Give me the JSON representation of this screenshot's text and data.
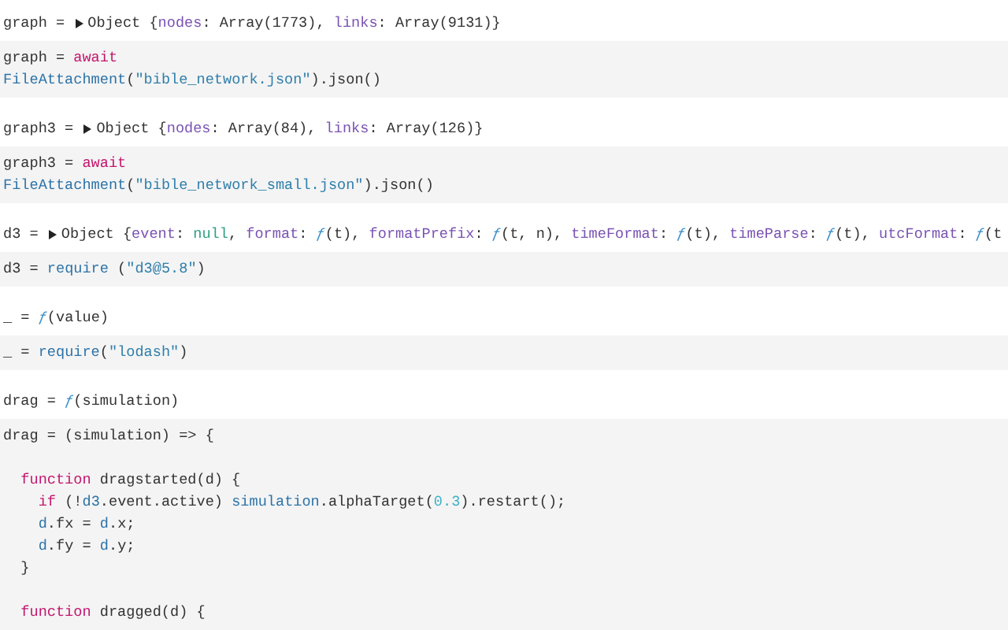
{
  "cells": [
    {
      "output": {
        "expanded": false,
        "tokens": [
          {
            "kind": "plain",
            "text": "graph = "
          },
          {
            "kind": "plain",
            "text": "Object {"
          },
          {
            "kind": "prop",
            "text": "nodes"
          },
          {
            "kind": "plain",
            "text": ": Array(1773), "
          },
          {
            "kind": "prop",
            "text": "links"
          },
          {
            "kind": "plain",
            "text": ": Array(9131)}"
          }
        ]
      },
      "source": [
        {
          "kind": "code",
          "tokens": [
            {
              "kind": "plain",
              "text": "graph = "
            },
            {
              "kind": "keyword",
              "text": "await"
            }
          ]
        },
        {
          "kind": "code",
          "tokens": [
            {
              "kind": "name",
              "text": "FileAttachment"
            },
            {
              "kind": "plain",
              "text": "("
            },
            {
              "kind": "string",
              "text": "\"bible_network.json\""
            },
            {
              "kind": "plain",
              "text": ").json()"
            }
          ]
        }
      ]
    },
    {
      "output": {
        "expanded": false,
        "tokens": [
          {
            "kind": "plain",
            "text": "graph3 = "
          },
          {
            "kind": "plain",
            "text": "Object {"
          },
          {
            "kind": "prop",
            "text": "nodes"
          },
          {
            "kind": "plain",
            "text": ": Array(84), "
          },
          {
            "kind": "prop",
            "text": "links"
          },
          {
            "kind": "plain",
            "text": ": Array(126)}"
          }
        ]
      },
      "source": [
        {
          "kind": "code",
          "tokens": [
            {
              "kind": "plain",
              "text": "graph3 = "
            },
            {
              "kind": "keyword",
              "text": "await"
            }
          ]
        },
        {
          "kind": "code",
          "tokens": [
            {
              "kind": "name",
              "text": "FileAttachment"
            },
            {
              "kind": "plain",
              "text": "("
            },
            {
              "kind": "string",
              "text": "\"bible_network_small.json\""
            },
            {
              "kind": "plain",
              "text": ").json()"
            }
          ]
        }
      ]
    },
    {
      "output": {
        "expanded": false,
        "tokens": [
          {
            "kind": "plain",
            "text": "d3 = "
          },
          {
            "kind": "plain",
            "text": "Object {"
          },
          {
            "kind": "prop",
            "text": "event"
          },
          {
            "kind": "plain",
            "text": ": "
          },
          {
            "kind": "null",
            "text": "null"
          },
          {
            "kind": "plain",
            "text": ", "
          },
          {
            "kind": "prop",
            "text": "format"
          },
          {
            "kind": "plain",
            "text": ": "
          },
          {
            "kind": "f",
            "text": "ƒ"
          },
          {
            "kind": "plain",
            "text": "(t), "
          },
          {
            "kind": "prop",
            "text": "formatPrefix"
          },
          {
            "kind": "plain",
            "text": ": "
          },
          {
            "kind": "f",
            "text": "ƒ"
          },
          {
            "kind": "plain",
            "text": "(t, n), "
          },
          {
            "kind": "prop",
            "text": "timeFormat"
          },
          {
            "kind": "plain",
            "text": ": "
          },
          {
            "kind": "f",
            "text": "ƒ"
          },
          {
            "kind": "plain",
            "text": "(t), "
          },
          {
            "kind": "prop",
            "text": "timeParse"
          },
          {
            "kind": "plain",
            "text": ": "
          },
          {
            "kind": "f",
            "text": "ƒ"
          },
          {
            "kind": "plain",
            "text": "(t), "
          },
          {
            "kind": "prop",
            "text": "utcFormat"
          },
          {
            "kind": "plain",
            "text": ": "
          },
          {
            "kind": "f",
            "text": "ƒ"
          },
          {
            "kind": "plain",
            "text": "(t"
          }
        ]
      },
      "source": [
        {
          "kind": "code",
          "tokens": [
            {
              "kind": "plain",
              "text": "d3 = "
            },
            {
              "kind": "name",
              "text": "require"
            },
            {
              "kind": "plain",
              "text": " ("
            },
            {
              "kind": "string",
              "text": "\"d3@5.8\""
            },
            {
              "kind": "plain",
              "text": ")"
            }
          ]
        }
      ]
    },
    {
      "output": {
        "tokens": [
          {
            "kind": "plain",
            "text": "_ = "
          },
          {
            "kind": "f",
            "text": "ƒ"
          },
          {
            "kind": "plain",
            "text": "(value)"
          }
        ]
      },
      "source": [
        {
          "kind": "code",
          "tokens": [
            {
              "kind": "plain",
              "text": "_ = "
            },
            {
              "kind": "name",
              "text": "require"
            },
            {
              "kind": "plain",
              "text": "("
            },
            {
              "kind": "string",
              "text": "\"lodash\""
            },
            {
              "kind": "plain",
              "text": ")"
            }
          ]
        }
      ]
    },
    {
      "output": {
        "tokens": [
          {
            "kind": "plain",
            "text": "drag = "
          },
          {
            "kind": "f",
            "text": "ƒ"
          },
          {
            "kind": "plain",
            "text": "(simulation)"
          }
        ]
      },
      "source": [
        {
          "kind": "code",
          "tokens": [
            {
              "kind": "plain",
              "text": "drag = (simulation) => {"
            }
          ]
        },
        {
          "kind": "blank"
        },
        {
          "kind": "code",
          "tokens": [
            {
              "kind": "keyword",
              "text": "  function"
            },
            {
              "kind": "plain",
              "text": " dragstarted(d) {"
            }
          ]
        },
        {
          "kind": "code",
          "tokens": [
            {
              "kind": "keyword",
              "text": "    if"
            },
            {
              "kind": "plain",
              "text": " (!"
            },
            {
              "kind": "name",
              "text": "d3"
            },
            {
              "kind": "plain",
              "text": ".event.active) "
            },
            {
              "kind": "name",
              "text": "simulation"
            },
            {
              "kind": "plain",
              "text": ".alphaTarget("
            },
            {
              "kind": "number",
              "text": "0.3"
            },
            {
              "kind": "plain",
              "text": ").restart();"
            }
          ]
        },
        {
          "kind": "code",
          "tokens": [
            {
              "kind": "name",
              "text": "    d"
            },
            {
              "kind": "plain",
              "text": ".fx = "
            },
            {
              "kind": "name",
              "text": "d"
            },
            {
              "kind": "plain",
              "text": ".x;"
            }
          ]
        },
        {
          "kind": "code",
          "tokens": [
            {
              "kind": "name",
              "text": "    d"
            },
            {
              "kind": "plain",
              "text": ".fy = "
            },
            {
              "kind": "name",
              "text": "d"
            },
            {
              "kind": "plain",
              "text": ".y;"
            }
          ]
        },
        {
          "kind": "code",
          "tokens": [
            {
              "kind": "plain",
              "text": "  }"
            }
          ]
        },
        {
          "kind": "blank"
        },
        {
          "kind": "code",
          "tokens": [
            {
              "kind": "keyword",
              "text": "  function"
            },
            {
              "kind": "plain",
              "text": " dragged(d) {"
            }
          ]
        }
      ]
    }
  ]
}
